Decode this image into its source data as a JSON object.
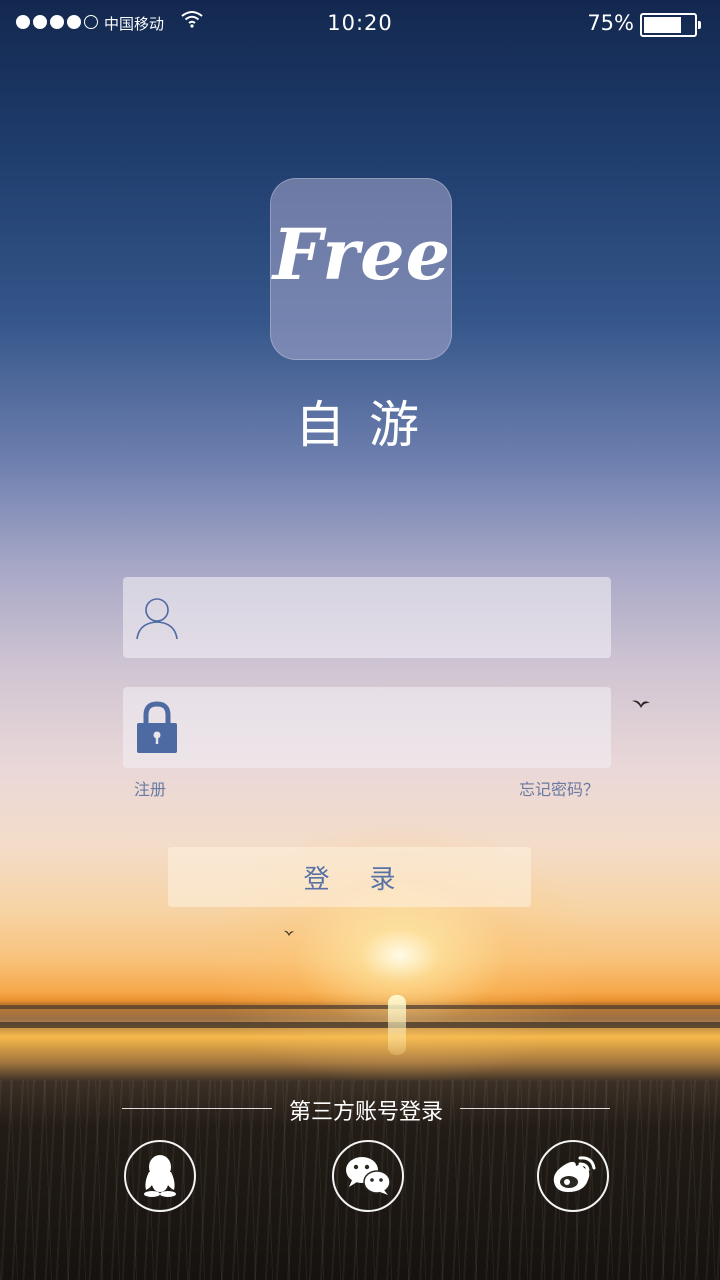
{
  "status_bar": {
    "signal_bars": 5,
    "signal_filled": 4,
    "carrier": "中国移动",
    "time": "10:20",
    "battery_percent": "75%",
    "battery_level": 0.75
  },
  "logo": {
    "text": "Free",
    "app_name": "自游"
  },
  "login_form": {
    "username_placeholder": "",
    "password_placeholder": "",
    "register_label": "注册",
    "forgot_password_label": "忘记密码？",
    "login_button_label": "登录"
  },
  "third_party": {
    "title": "第三方账号登录",
    "providers": [
      "qq-icon",
      "wechat-icon",
      "weibo-icon"
    ]
  },
  "colors": {
    "accent": "#5872a6",
    "icon_blue": "#4d6aa3",
    "text_light": "#ffffff"
  }
}
